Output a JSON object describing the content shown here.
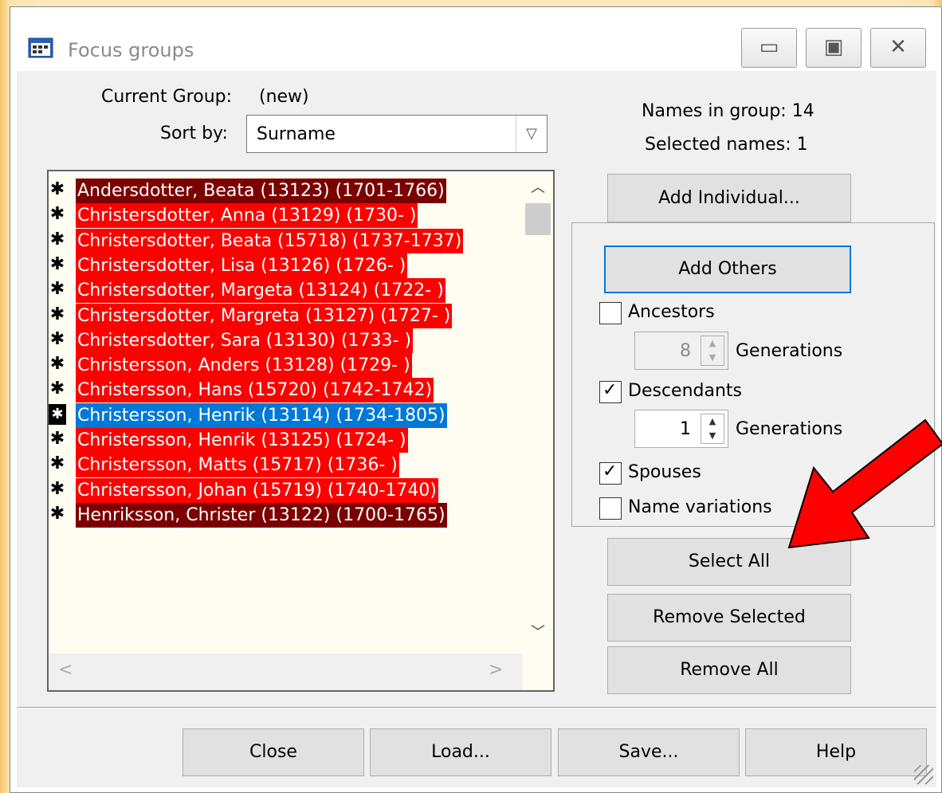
{
  "window": {
    "title": "Focus groups",
    "controls": {
      "minimize": "▭",
      "maximize": "▣",
      "close": "✕"
    }
  },
  "header": {
    "current_group_label": "Current Group:",
    "current_group_value": "(new)",
    "sort_by_label": "Sort by:",
    "sort_by_value": "Surname",
    "names_in_group": "Names in group: 14",
    "selected_names": "Selected names: 1"
  },
  "list": {
    "colors": {
      "dark": "#7b0000",
      "red": "#ff0000",
      "selected": "#0078d7"
    },
    "items": [
      {
        "star": "✱",
        "text": "Andersdotter, Beata (13123) (1701-1766)",
        "style": "dark"
      },
      {
        "star": "✱",
        "text": "Christersdotter, Anna (13129) (1730-   )",
        "style": "red"
      },
      {
        "star": "✱",
        "text": "Christersdotter, Beata (15718) (1737-1737)",
        "style": "red"
      },
      {
        "star": "✱",
        "text": "Christersdotter, Lisa (13126) (1726-   )",
        "style": "red"
      },
      {
        "star": "✱",
        "text": "Christersdotter, Margeta (13124) (1722-   )",
        "style": "red"
      },
      {
        "star": "✱",
        "text": "Christersdotter, Margreta (13127) (1727-   )",
        "style": "red"
      },
      {
        "star": "✱",
        "text": "Christersdotter, Sara (13130) (1733-   )",
        "style": "red"
      },
      {
        "star": "✱",
        "text": "Christersson, Anders (13128) (1729-   )",
        "style": "red"
      },
      {
        "star": "✱",
        "text": "Christersson, Hans (15720) (1742-1742)",
        "style": "red"
      },
      {
        "star": "✱",
        "text": "Christersson, Henrik (13114) (1734-1805)",
        "style": "selected"
      },
      {
        "star": "✱",
        "text": "Christersson, Henrik (13125) (1724-   )",
        "style": "red"
      },
      {
        "star": "✱",
        "text": "Christersson, Matts (15717) (1736-   )",
        "style": "red"
      },
      {
        "star": "✱",
        "text": "Christersson, Johan (15719) (1740-1740)",
        "style": "red"
      },
      {
        "star": "✱",
        "text": "Henriksson, Christer (13122) (1700-1765)",
        "style": "dark"
      }
    ]
  },
  "buttons": {
    "add_individual": "Add Individual...",
    "add_others": "Add Others",
    "select_all": "Select All",
    "remove_selected": "Remove Selected",
    "remove_all": "Remove All",
    "close": "Close",
    "load": "Load...",
    "save": "Save...",
    "help": "Help"
  },
  "options": {
    "ancestors_label": "Ancestors",
    "ancestors_checked": false,
    "ancestors_generations": "8",
    "descendants_label": "Descendants",
    "descendants_checked": true,
    "descendants_generations": "1",
    "generations_label": "Generations",
    "spouses_label": "Spouses",
    "spouses_checked": true,
    "name_variations_label": "Name variations",
    "name_variations_checked": false
  },
  "annotation": {
    "arrow_color": "#ff0000"
  }
}
